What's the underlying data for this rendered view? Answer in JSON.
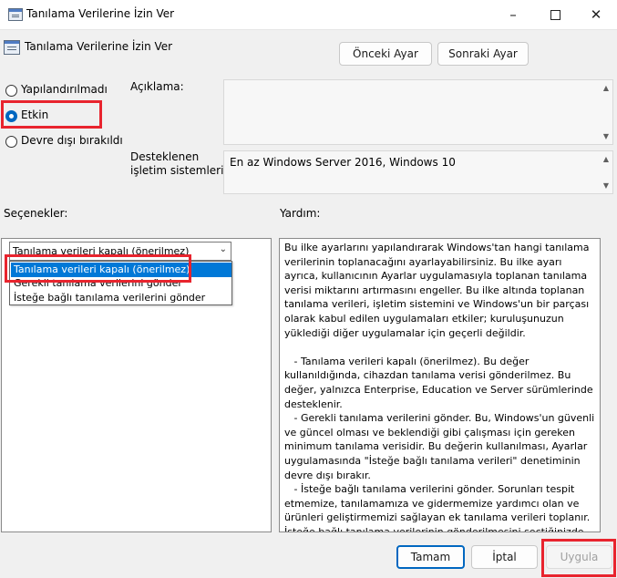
{
  "window": {
    "title": "Tanılama Verilerine İzin Ver"
  },
  "header": {
    "policy_title": "Tanılama Verilerine İzin Ver",
    "prev_button": "Önceki Ayar",
    "next_button": "Sonraki Ayar"
  },
  "state": {
    "options": [
      {
        "label": "Yapılandırılmadı",
        "selected": false
      },
      {
        "label": "Etkin",
        "selected": true
      },
      {
        "label": "Devre dışı bırakıldı",
        "selected": false
      }
    ]
  },
  "fields": {
    "comment_label": "Açıklama:",
    "comment_value": "",
    "supported_label_line1": "Desteklenen",
    "supported_label_line2": "işletim sistemleri:",
    "supported_value": "En az Windows Server 2016, Windows 10"
  },
  "sections": {
    "options_label": "Seçenekler:",
    "help_label": "Yardım:"
  },
  "options_panel": {
    "combo_value": "Tanılama verileri kapalı (önerilmez)",
    "dropdown_items": [
      "Tanılama verileri kapalı (önerilmez)",
      "Gerekli tanılama verilerini gönder",
      "İsteğe bağlı tanılama verilerini gönder"
    ],
    "selected_index": 0
  },
  "help": {
    "text": "Bu ilke ayarlarını yapılandırarak Windows'tan hangi tanılama verilerinin toplanacağını ayarlayabilirsiniz. Bu ilke ayarı ayrıca, kullanıcının Ayarlar uygulamasıyla toplanan tanılama verisi miktarını artırmasını engeller. Bu ilke altında toplanan tanılama verileri, işletim sistemini ve Windows'un bir parçası olarak kabul edilen uygulamaları etkiler; kuruluşunuzun yüklediği diğer uygulamalar için geçerli değildir.\n\n   - Tanılama verileri kapalı (önerilmez). Bu değer kullanıldığında, cihazdan tanılama verisi gönderilmez. Bu değer, yalnızca Enterprise, Education ve Server sürümlerinde desteklenir.\n   - Gerekli tanılama verilerini gönder. Bu, Windows'un güvenli ve güncel olması ve beklendiği gibi çalışması için gereken minimum tanılama verisidir. Bu değerin kullanılması, Ayarlar uygulamasında \"İsteğe bağlı tanılama verileri\" denetiminin devre dışı bırakır.\n   - İsteğe bağlı tanılama verilerini gönder. Sorunları tespit etmemize, tanılamamıza ve gidermemize yardımcı olan ve ürünleri geliştirmemizi sağlayan ek tanılama verileri toplanır. İsteğe bağlı tanılama verilerinin gönderilmesini seçtiğinizde, gerekli tanılama verileri her zaman dahil edilir.  İsteğe bağlı tanılama verileri, kaza sonucu oluşan web sitesi ve belgelerle ilgili içerik bilgilerini de içerebilir."
  },
  "footer": {
    "ok_button": "Tamam",
    "cancel_button": "İptal",
    "apply_button": "Uygula"
  },
  "icons": {
    "app": "policy-window-icon",
    "minimize": "minimize-icon",
    "maximize": "maximize-icon",
    "close": "close-icon",
    "chevron": "chevron-down-icon",
    "scroll_up": "scroll-up-arrow-icon",
    "scroll_down": "scroll-down-arrow-icon"
  },
  "colors": {
    "accent": "#0067c0",
    "highlight": "#e8242e",
    "selection": "#0078d7"
  }
}
